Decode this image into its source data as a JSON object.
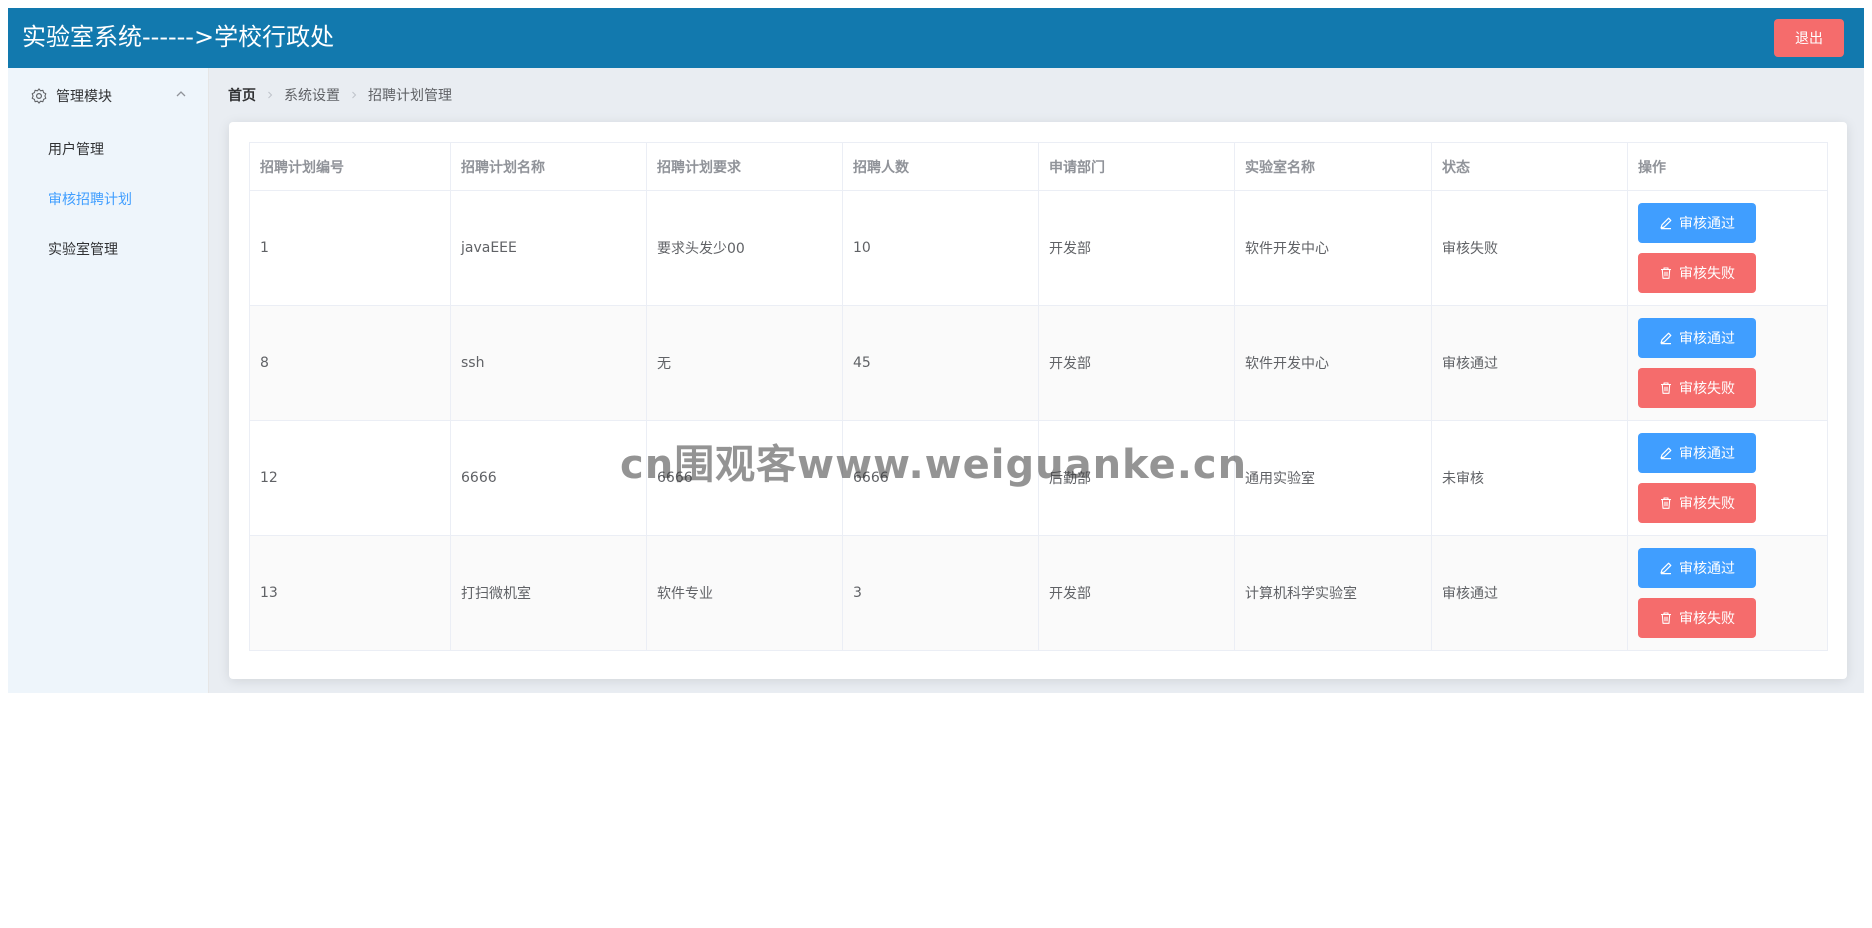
{
  "header": {
    "title": "实验室系统------>学校行政处",
    "logout_label": "退出"
  },
  "sidebar": {
    "group": {
      "label": "管理模块",
      "icon": "gear-icon",
      "expanded": true
    },
    "items": [
      {
        "label": "用户管理",
        "active": false
      },
      {
        "label": "审核招聘计划",
        "active": true
      },
      {
        "label": "实验室管理",
        "active": false
      }
    ]
  },
  "breadcrumb": [
    "首页",
    "系统设置",
    "招聘计划管理"
  ],
  "table": {
    "columns": [
      "招聘计划编号",
      "招聘计划名称",
      "招聘计划要求",
      "招聘人数",
      "申请部门",
      "实验室名称",
      "状态",
      "操作"
    ],
    "rows": [
      {
        "id": "1",
        "name": "javaEEE",
        "requirement": "要求头发少00",
        "count": "10",
        "dept": "开发部",
        "lab": "软件开发中心",
        "status": "审核失败"
      },
      {
        "id": "8",
        "name": "ssh",
        "requirement": "无",
        "count": "45",
        "dept": "开发部",
        "lab": "软件开发中心",
        "status": "审核通过"
      },
      {
        "id": "12",
        "name": "6666",
        "requirement": "6666",
        "count": "6666",
        "dept": "后勤部",
        "lab": "通用实验室",
        "status": "未审核"
      },
      {
        "id": "13",
        "name": "打扫微机室",
        "requirement": "软件专业",
        "count": "3",
        "dept": "开发部",
        "lab": "计算机科学实验室",
        "status": "审核通过"
      }
    ],
    "approve_label": "审核通过",
    "reject_label": "审核失败"
  },
  "watermark": "cn围观客www.weiguanke.cn",
  "colors": {
    "header_bg": "#1279ae",
    "primary": "#409eff",
    "danger": "#f56c6c",
    "sidebar_bg": "#eef5fb",
    "content_bg": "#e9edf2"
  }
}
